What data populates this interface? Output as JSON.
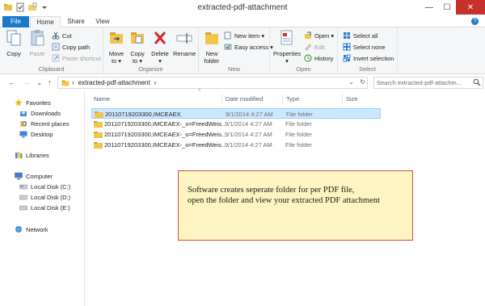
{
  "window": {
    "title": "extracted-pdf-attachment",
    "minimize": "—",
    "maximize": "☐",
    "close": "✕"
  },
  "ribbon_tabs": [
    {
      "label": "File"
    },
    {
      "label": "Home"
    },
    {
      "label": "Share"
    },
    {
      "label": "View"
    }
  ],
  "help": "?",
  "clipboard": {
    "copy": "Copy",
    "paste": "Paste",
    "cut": "Cut",
    "copy_path": "Copy path",
    "paste_shortcut": "Paste shortcut",
    "group": "Clipboard"
  },
  "organize": {
    "move_to_1": "Move",
    "move_to_2": "to ▾",
    "copy_to_1": "Copy",
    "copy_to_2": "to ▾",
    "delete_1": "Delete",
    "delete_2": "▾",
    "rename": "Rename",
    "group": "Organize"
  },
  "new": {
    "new_folder_1": "New",
    "new_folder_2": "folder",
    "new_item": "New item ▾",
    "easy_access": "Easy access ▾",
    "group": "New"
  },
  "open": {
    "properties_1": "Properties",
    "properties_2": "▾",
    "open": "Open ▾",
    "edit": "Edit",
    "history": "History",
    "group": "Open"
  },
  "select": {
    "select_all": "Select all",
    "select_none": "Select none",
    "invert": "Invert selection",
    "group": "Select"
  },
  "address": {
    "back": "←",
    "forward": "→",
    "recent": "⌄",
    "up": "↑",
    "path": "extracted-pdf-attachment",
    "sep1": "›",
    "sep2": "›",
    "dropdown": "⌄",
    "refresh": "↻"
  },
  "search": {
    "placeholder": "Search extracted-pdf-attachm...",
    "icon": "search-icon"
  },
  "nav_pane": {
    "favorites": "Favorites",
    "downloads": "Downloads",
    "recent_places": "Recent places",
    "desktop": "Desktop",
    "libraries": "Libraries",
    "computer": "Computer",
    "disk_c": "Local Disk (C:)",
    "disk_d": "Local Disk (D:)",
    "disk_e": "Local Disk (E:)",
    "network": "Network"
  },
  "columns": {
    "name": "Name",
    "date": "Date modified",
    "type": "Type",
    "size": "Size",
    "sort": "^"
  },
  "files": [
    {
      "name": "20110719203300,IMCEAEX",
      "date": "9/1/2014 4:27 AM",
      "type": "File folder"
    },
    {
      "name": "20110719203300,IMCEAEX-_o=FreedWeis...",
      "date": "9/1/2014 4:27 AM",
      "type": "File folder"
    },
    {
      "name": "20110719203300,IMCEAEX-_o=FreedWeis...",
      "date": "9/1/2014 4:27 AM",
      "type": "File folder"
    },
    {
      "name": "20110719203300,IMCEAEX-_o=FreedWeis...",
      "date": "9/1/2014 4:27 AM",
      "type": "File folder"
    }
  ],
  "note": {
    "line1": "Software creates seperate folder for per PDF file,",
    "line2": "open the folder and view your extracted PDF attachment"
  },
  "colors": {
    "accent": "#1979ca",
    "selection": "#cce8ff",
    "note_bg": "#fdf5c1",
    "note_border": "#d44a3a"
  }
}
